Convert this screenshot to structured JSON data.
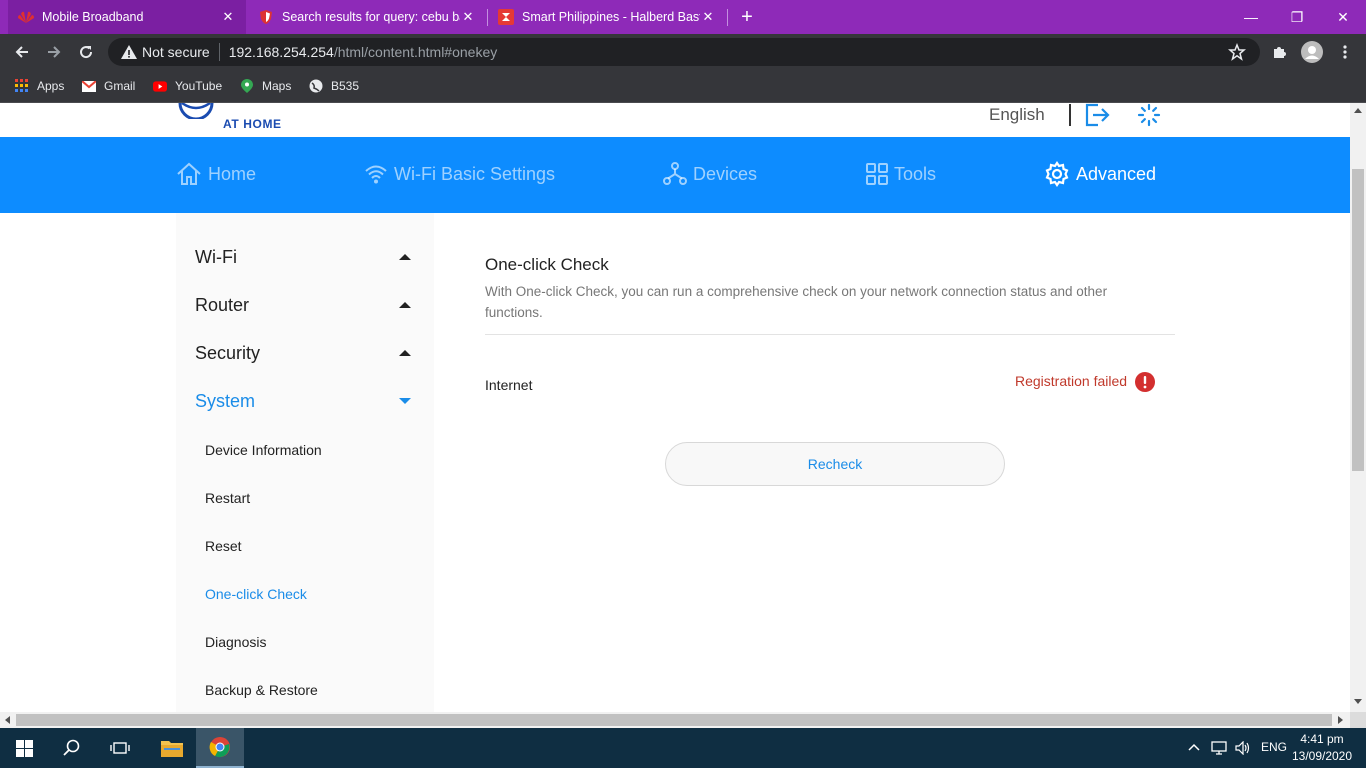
{
  "browser": {
    "tabs": [
      {
        "title": "Mobile Broadband",
        "active": true
      },
      {
        "title": "Search results for query: cebu ba",
        "active": false
      },
      {
        "title": "Smart Philippines - Halberd Bast",
        "active": false
      }
    ],
    "new_tab": "+",
    "window": {
      "minimize": "—",
      "restore": "❐",
      "close": "✕"
    },
    "address": {
      "security": "Not secure",
      "host": "192.168.254.254",
      "path": "/html/content.html#onekey"
    },
    "bookmarks": [
      "Apps",
      "Gmail",
      "YouTube",
      "Maps",
      "B535"
    ]
  },
  "header": {
    "logo_text": "AT HOME",
    "language": "English"
  },
  "nav": {
    "items": [
      {
        "label": "Home",
        "icon": "home-icon"
      },
      {
        "label": "Wi-Fi Basic Settings",
        "icon": "wifi-icon"
      },
      {
        "label": "Devices",
        "icon": "devices-icon"
      },
      {
        "label": "Tools",
        "icon": "tools-icon"
      },
      {
        "label": "Advanced",
        "icon": "gear-icon",
        "active": true
      }
    ]
  },
  "sidebar": {
    "groups": [
      {
        "label": "Wi-Fi",
        "expanded": false
      },
      {
        "label": "Router",
        "expanded": false
      },
      {
        "label": "Security",
        "expanded": false
      },
      {
        "label": "System",
        "expanded": true
      }
    ],
    "system_items": [
      {
        "label": "Device Information"
      },
      {
        "label": "Restart"
      },
      {
        "label": "Reset"
      },
      {
        "label": "One-click Check",
        "active": true
      },
      {
        "label": "Diagnosis"
      },
      {
        "label": "Backup & Restore"
      }
    ]
  },
  "content": {
    "title": "One-click Check",
    "description": "With One-click Check, you can run a comprehensive check on your network connection status and other functions.",
    "row_label": "Internet",
    "row_status": "Registration failed",
    "recheck_label": "Recheck"
  },
  "taskbar": {
    "lang": "ENG",
    "time": "4:41 pm",
    "date": "13/09/2020"
  },
  "colors": {
    "tab_bar": "#8e2ab8",
    "nav_bar": "#0d8cff",
    "accent": "#1a8ce8",
    "error": "#c0392b"
  }
}
